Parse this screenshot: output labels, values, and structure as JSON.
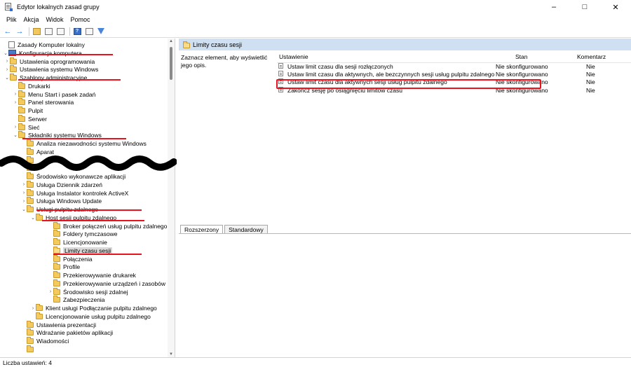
{
  "window": {
    "title": "Edytor lokalnych zasad grupy",
    "controls": {
      "minimize": "–",
      "maximize": "□",
      "close": "✕"
    }
  },
  "menu": [
    "Plik",
    "Akcja",
    "Widok",
    "Pomoc"
  ],
  "toolbar": {
    "icons": [
      "back-arrow-icon",
      "forward-arrow-icon",
      "folder-up-icon",
      "show-hide-tree-icon",
      "export-list-icon",
      "help-icon",
      "properties-icon",
      "filter-icon"
    ]
  },
  "tree": [
    {
      "label": "Zasady Komputer lokalny",
      "depth": 0,
      "expand": "",
      "icon": "policy"
    },
    {
      "label": "Konfiguracja komputera",
      "depth": 0,
      "expand": "open",
      "icon": "pc"
    },
    {
      "label": "Ustawienia oprogramowania",
      "depth": 1,
      "expand": "closed",
      "icon": "folder"
    },
    {
      "label": "Ustawienia systemu Windows",
      "depth": 1,
      "expand": "closed",
      "icon": "folder"
    },
    {
      "label": "Szablony administracyjne",
      "depth": 1,
      "expand": "open",
      "icon": "folder"
    },
    {
      "label": "Drukarki",
      "depth": 2,
      "expand": "",
      "icon": "folder"
    },
    {
      "label": "Menu Start i pasek zadań",
      "depth": 2,
      "expand": "closed",
      "icon": "folder"
    },
    {
      "label": "Panel sterowania",
      "depth": 2,
      "expand": "closed",
      "icon": "folder"
    },
    {
      "label": "Pulpit",
      "depth": 2,
      "expand": "",
      "icon": "folder"
    },
    {
      "label": "Serwer",
      "depth": 2,
      "expand": "",
      "icon": "folder"
    },
    {
      "label": "Sieć",
      "depth": 2,
      "expand": "closed",
      "icon": "folder"
    },
    {
      "label": "Składniki systemu Windows",
      "depth": 2,
      "expand": "open",
      "icon": "folder"
    },
    {
      "label": "Analiza niezawodności systemu Windows",
      "depth": 3,
      "expand": "",
      "icon": "folder"
    },
    {
      "label": "Aparat",
      "depth": 3,
      "expand": "",
      "icon": "folder"
    },
    {
      "label": "",
      "depth": 3,
      "expand": "",
      "icon": "folder"
    },
    {
      "label": "",
      "depth": 3,
      "expand": "",
      "icon": "folder"
    },
    {
      "label": "Środowisko wykonawcze aplikacji",
      "depth": 3,
      "expand": "",
      "icon": "folder"
    },
    {
      "label": "Usługa Dziennik zdarzeń",
      "depth": 3,
      "expand": "closed",
      "icon": "folder"
    },
    {
      "label": "Usługa Instalator kontrolek ActiveX",
      "depth": 3,
      "expand": "closed",
      "icon": "folder"
    },
    {
      "label": "Usługa Windows Update",
      "depth": 3,
      "expand": "closed",
      "icon": "folder"
    },
    {
      "label": "Usługi pulpitu zdalnego",
      "depth": 3,
      "expand": "open",
      "icon": "folder"
    },
    {
      "label": "Host sesji pulpitu zdalnego",
      "depth": 4,
      "expand": "open",
      "icon": "folder"
    },
    {
      "label": "Broker połączeń usług pulpitu zdalnego",
      "depth": 5,
      "expand": "",
      "icon": "folder"
    },
    {
      "label": "Foldery tymczasowe",
      "depth": 5,
      "expand": "",
      "icon": "folder"
    },
    {
      "label": "Licencjonowanie",
      "depth": 5,
      "expand": "",
      "icon": "folder"
    },
    {
      "label": "Limity czasu sesji",
      "depth": 5,
      "expand": "",
      "icon": "folder-open",
      "selected": true
    },
    {
      "label": "Połączenia",
      "depth": 5,
      "expand": "",
      "icon": "folder"
    },
    {
      "label": "Profile",
      "depth": 5,
      "expand": "",
      "icon": "folder"
    },
    {
      "label": "Przekierowywanie drukarek",
      "depth": 5,
      "expand": "",
      "icon": "folder"
    },
    {
      "label": "Przekierowywanie urządzeń i zasobów",
      "depth": 5,
      "expand": "",
      "icon": "folder"
    },
    {
      "label": "Środowisko sesji zdalnej",
      "depth": 5,
      "expand": "closed",
      "icon": "folder"
    },
    {
      "label": "Zabezpieczenia",
      "depth": 5,
      "expand": "",
      "icon": "folder"
    },
    {
      "label": "Klient usługi Podłączanie pulpitu zdalnego",
      "depth": 4,
      "expand": "closed",
      "icon": "folder"
    },
    {
      "label": "Licencjonowanie usług pulpitu zdalnego",
      "depth": 4,
      "expand": "",
      "icon": "folder"
    },
    {
      "label": "Ustawienia prezentacji",
      "depth": 3,
      "expand": "",
      "icon": "folder"
    },
    {
      "label": "Wdrażanie pakietów aplikacji",
      "depth": 3,
      "expand": "",
      "icon": "folder"
    },
    {
      "label": "Wiadomości",
      "depth": 3,
      "expand": "",
      "icon": "folder"
    },
    {
      "label": "",
      "depth": 3,
      "expand": "",
      "icon": "folder"
    }
  ],
  "right": {
    "header": "Limity czasu sesji",
    "description": "Zaznacz element, aby wyświetlić jego opis.",
    "columns": {
      "setting": "Ustawienie",
      "state": "Stan",
      "comment": "Komentarz"
    },
    "rows": [
      {
        "setting": "Ustaw limit czasu dla sesji rozłączonych",
        "state": "Nie skonfigurowano",
        "comment": "Nie"
      },
      {
        "setting": "Ustaw limit czasu dla aktywnych, ale bezczynnych sesji usług pulpitu zdalnego",
        "state": "Nie skonfigurowano",
        "comment": "Nie"
      },
      {
        "setting": "Ustaw limit czasu dla aktywnych sesji usług pulpitu zdalnego",
        "state": "Nie skonfigurowano",
        "comment": "Nie"
      },
      {
        "setting": "Zakończ sesję po osiągnięciu limitów czasu",
        "state": "Nie skonfigurowano",
        "comment": "Nie"
      }
    ],
    "tabs": [
      "Rozszerzony",
      "Standardowy"
    ]
  },
  "status": "Liczba ustawień: 4",
  "colors": {
    "annotation": "#e8131d",
    "header_bg": "#cfe0f3",
    "folder": "#f4c95d"
  }
}
